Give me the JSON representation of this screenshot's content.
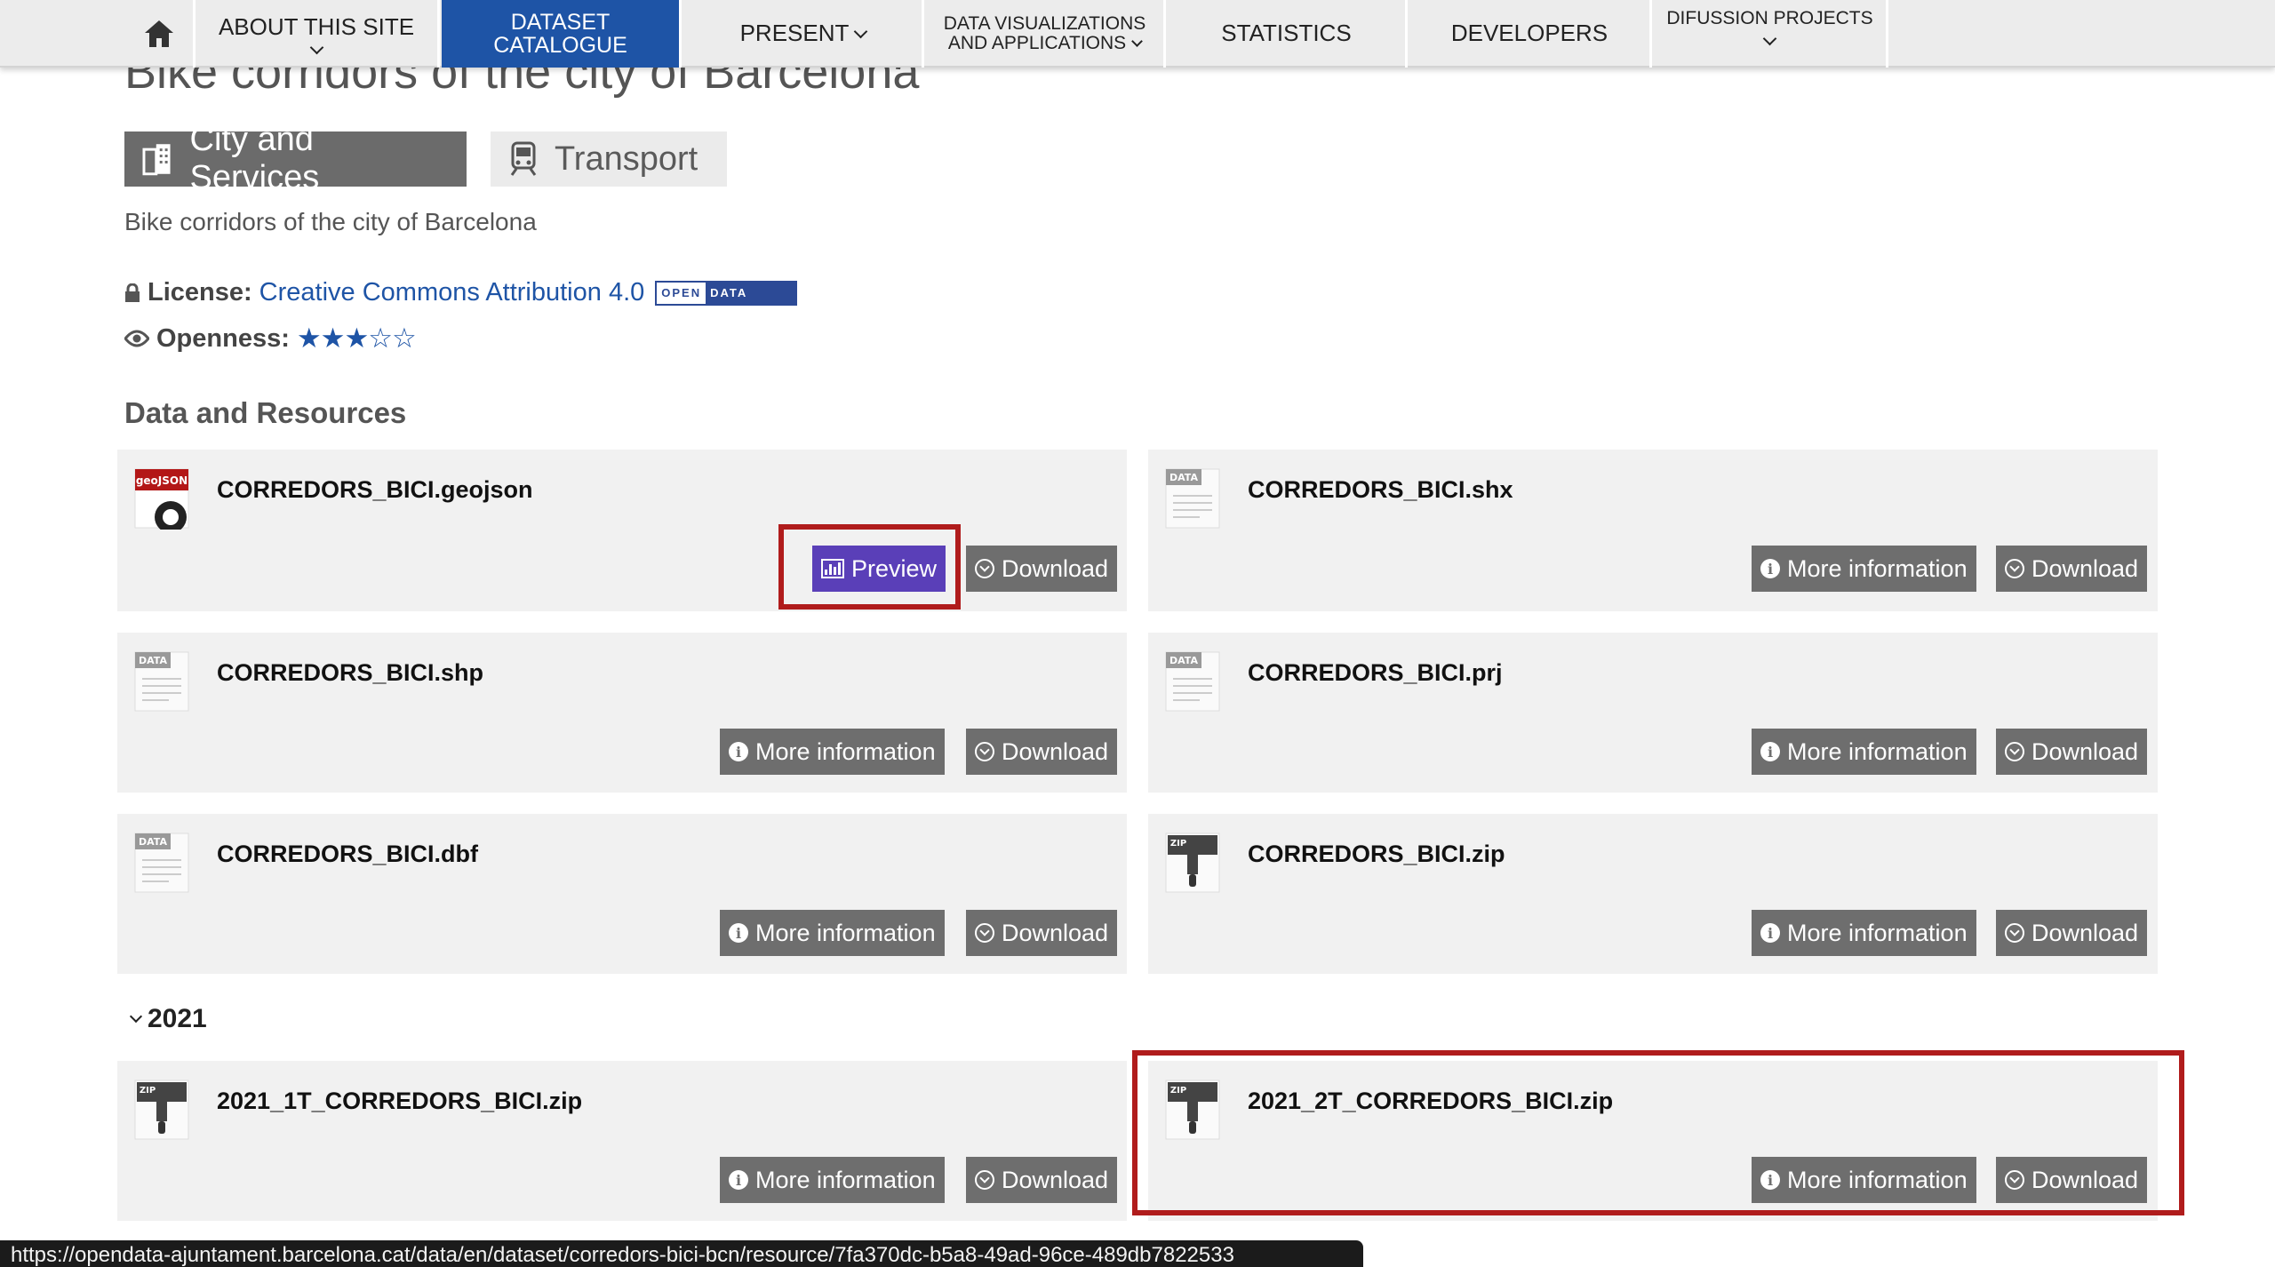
{
  "nav": {
    "items": [
      {
        "label": "ABOUT THIS SITE"
      },
      {
        "label": "DATASET CATALOGUE",
        "line1": "DATASET",
        "line2": "CATALOGUE"
      },
      {
        "label": "PRESENT"
      },
      {
        "label": "DATA VISUALIZATIONS AND APPLICATIONS",
        "line1": "DATA VISUALIZATIONS",
        "line2": "AND APPLICATIONS"
      },
      {
        "label": "STATISTICS"
      },
      {
        "label": "DEVELOPERS"
      },
      {
        "label": "DIFUSSION PROJECTS"
      }
    ],
    "active_color": "#1e54a6"
  },
  "dataset": {
    "title": "Bike corridors of the city of Barcelona",
    "tags": [
      "City and Services",
      "Transport"
    ],
    "description": "Bike corridors of the city of Barcelona",
    "license_label": "License:",
    "license_value": "Creative Commons Attribution 4.0",
    "badge_open": "OPEN",
    "badge_data": "DATA",
    "openness_label": "Openness:",
    "openness_stars": "★★★☆☆",
    "openness_rating": 3
  },
  "resources": {
    "heading": "Data and Resources",
    "more_info_label": "More information",
    "download_label": "Download",
    "preview_label": "Preview",
    "items": [
      {
        "name": "CORREDORS_BICI.geojson",
        "icon": "geojson-file-icon",
        "icon_text": "geoJSON"
      },
      {
        "name": "CORREDORS_BICI.shx",
        "icon": "data-file-icon",
        "icon_text": "DATA"
      },
      {
        "name": "CORREDORS_BICI.shp",
        "icon": "data-file-icon",
        "icon_text": "DATA"
      },
      {
        "name": "CORREDORS_BICI.prj",
        "icon": "data-file-icon",
        "icon_text": "DATA"
      },
      {
        "name": "CORREDORS_BICI.dbf",
        "icon": "data-file-icon",
        "icon_text": "DATA"
      },
      {
        "name": "CORREDORS_BICI.zip",
        "icon": "zip-file-icon",
        "icon_text": "ZIP"
      }
    ],
    "year_group": "2021",
    "year_items": [
      {
        "name": "2021_1T_CORREDORS_BICI.zip",
        "icon": "zip-file-icon",
        "icon_text": "ZIP"
      },
      {
        "name": "2021_2T_CORREDORS_BICI.zip",
        "icon": "zip-file-icon",
        "icon_text": "ZIP"
      }
    ]
  },
  "status_bar": {
    "url": "https://opendata-ajuntament.barcelona.cat/data/en/dataset/corredors-bici-bcn/resource/7fa370dc-b5a8-49ad-96ce-489db7822533"
  },
  "colors": {
    "highlight": "#b01c1c",
    "preview_button": "#5a3fb8",
    "button": "#6e6e6e",
    "link": "#1e54a6"
  }
}
